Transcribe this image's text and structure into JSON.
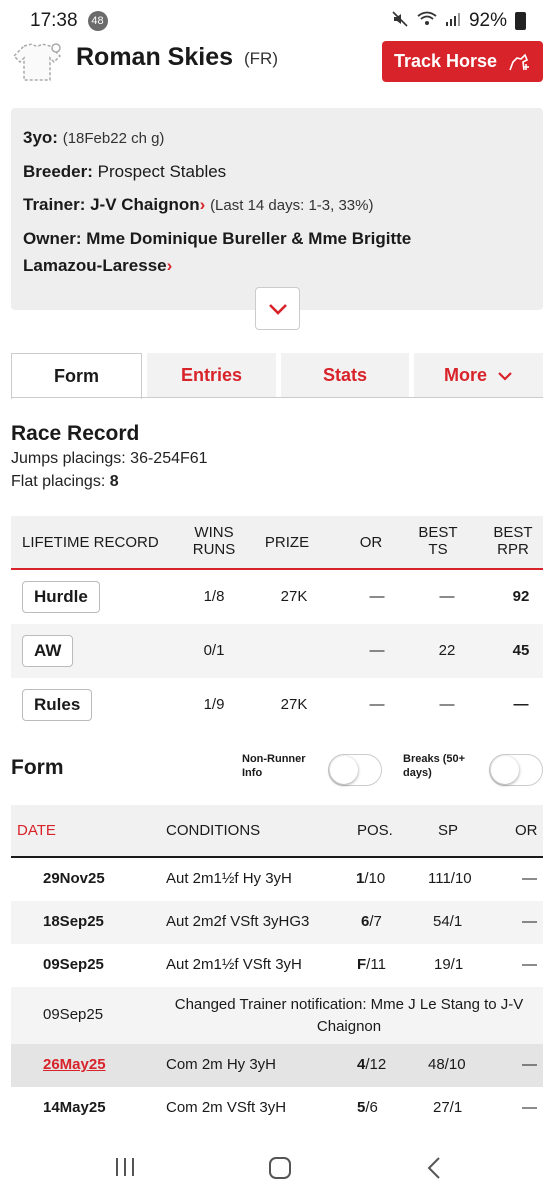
{
  "status_bar": {
    "time": "17:38",
    "notif_count": "48",
    "battery": "92%"
  },
  "header": {
    "horse_name": "Roman Skies",
    "country": "(FR)",
    "track_button": "Track Horse"
  },
  "info": {
    "age_label": "3yo:",
    "age_value": "(18Feb22 ch g)",
    "breeder_label": "Breeder:",
    "breeder_value": "Prospect Stables",
    "trainer_label": "Trainer:",
    "trainer_value": "J-V Chaignon",
    "trainer_stats": "(Last 14 days: 1-3, 33%)",
    "owner_label": "Owner:",
    "owner_value_1": "Mme Dominique Bureller & Mme Brigitte",
    "owner_value_2": "Lamazou-Laresse",
    "chevron": "›"
  },
  "tabs": {
    "form": "Form",
    "entries": "Entries",
    "stats": "Stats",
    "more": "More"
  },
  "race_record": {
    "title": "Race Record",
    "jumps_label": "Jumps placings: ",
    "jumps_value": "36-254F61",
    "flat_label": "Flat placings: ",
    "flat_value": "8"
  },
  "lifetime": {
    "headers": {
      "record": "LIFETIME RECORD",
      "wins": "WINS",
      "runs": "RUNS",
      "prize": "PRIZE",
      "or": "OR",
      "best": "BEST",
      "ts": "TS",
      "rpr": "RPR"
    },
    "rows": [
      {
        "type": "Hurdle",
        "winsruns": "1/8",
        "prize": "27K",
        "or": "—",
        "ts": "—",
        "rpr": "92"
      },
      {
        "type": "AW",
        "winsruns": "0/1",
        "prize": "",
        "or": "—",
        "ts": "22",
        "rpr": "45"
      },
      {
        "type": "Rules",
        "winsruns": "1/9",
        "prize": "27K",
        "or": "—",
        "ts": "—",
        "rpr": "—"
      }
    ]
  },
  "form": {
    "title": "Form",
    "toggle1_label_1": "Non-Runner",
    "toggle1_label_2": "Info",
    "toggle2_label_1": "Breaks (50+",
    "toggle2_label_2": "days)",
    "headers": {
      "date": "DATE",
      "conditions": "CONDITIONS",
      "pos": "POS.",
      "sp": "SP",
      "or": "OR"
    },
    "rows": [
      {
        "date": "29Nov25",
        "conditions": "Aut 2m1½f Hy 3yH",
        "pos_main": "1",
        "pos_rest": "/10",
        "sp": "111/10",
        "or": "—"
      },
      {
        "date": "18Sep25",
        "conditions": "Aut 2m2f VSft 3yHG3",
        "pos_main": "6",
        "pos_rest": "/7",
        "sp": "54/1",
        "or": "—"
      },
      {
        "date": "09Sep25",
        "conditions": "Aut 2m1½f VSft 3yH",
        "pos_main": "F",
        "pos_rest": "/11",
        "sp": "19/1",
        "or": "—"
      }
    ],
    "notice": {
      "date": "09Sep25",
      "text_1": "Changed Trainer notification: Mme J Le Stang to J-V",
      "text_2": "Chaignon"
    },
    "rows2": [
      {
        "date": "26May25",
        "conditions": "Com 2m Hy 3yH",
        "pos_main": "4",
        "pos_rest": "/12",
        "sp": "48/10",
        "or": "—"
      },
      {
        "date": "14May25",
        "conditions": "Com 2m VSft 3yH",
        "pos_main": "5",
        "pos_rest": "/6",
        "sp": "27/1",
        "or": "—"
      }
    ]
  },
  "colors": {
    "accent": "#d8232a",
    "panel": "#eeeeee"
  }
}
